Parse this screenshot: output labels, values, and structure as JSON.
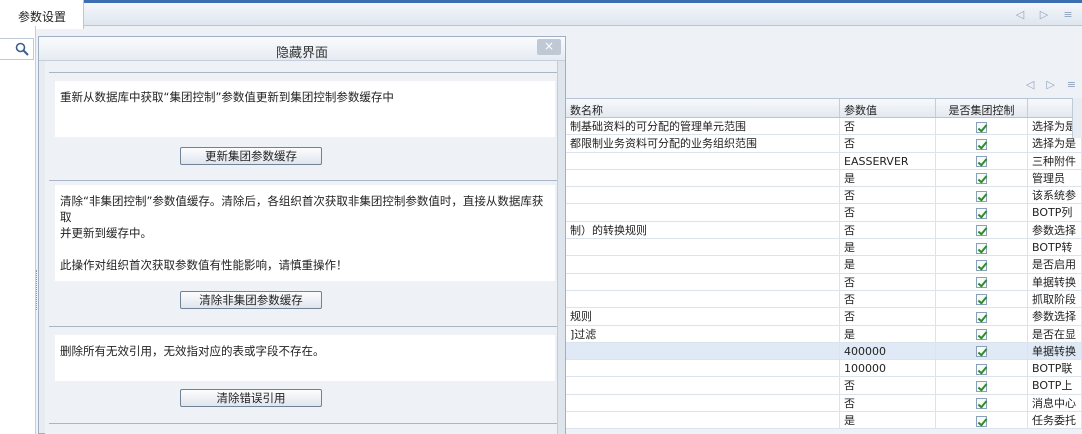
{
  "tabs": {
    "active": "参数设置"
  },
  "dialog": {
    "title": "隐藏界面",
    "close": "×",
    "sections": [
      {
        "lines": [
          "重新从数据库中获取“集团控制”参数值更新到集团控制参数缓存中"
        ],
        "button": "更新集团参数缓存"
      },
      {
        "lines": [
          "清除“非集团控制”参数值缓存。清除后，各组织首次获取非集团控制参数值时，直接从数据库获取",
          "并更新到缓存中。",
          "",
          "此操作对组织首次获取参数值有性能影响，请慎重操作！"
        ],
        "button": "清除非集团参数缓存"
      },
      {
        "lines": [
          "删除所有无效引用，无效指对应的表或字段不存在。"
        ],
        "button": "清除错误引用"
      }
    ]
  },
  "table": {
    "columns": [
      "数名称",
      "参数值",
      "是否集团控制",
      ""
    ],
    "rows": [
      {
        "name": "制基础资料的可分配的管理单元范围",
        "value": "否",
        "desc": "选择为是",
        "sel": false
      },
      {
        "name": "都限制业务资料可分配的业务组织范围",
        "value": "否",
        "desc": "选择为是",
        "sel": false
      },
      {
        "name": "",
        "value": "EASSERVER",
        "desc": "三种附件",
        "sel": false
      },
      {
        "name": "",
        "value": "是",
        "desc": "管理员",
        "sel": false
      },
      {
        "name": "",
        "value": "否",
        "desc": "该系统参",
        "sel": false
      },
      {
        "name": "",
        "value": "否",
        "desc": "BOTP列",
        "sel": false
      },
      {
        "name": "制）的转换规则",
        "value": "否",
        "desc": "参数选择",
        "sel": false
      },
      {
        "name": "",
        "value": "是",
        "desc": "BOTP转",
        "sel": false
      },
      {
        "name": "",
        "value": "是",
        "desc": "是否启用",
        "sel": false
      },
      {
        "name": "",
        "value": "否",
        "desc": "单据转换",
        "sel": false
      },
      {
        "name": "",
        "value": "否",
        "desc": "抓取阶段",
        "sel": false
      },
      {
        "name": "规则",
        "value": "否",
        "desc": "参数选择",
        "sel": false
      },
      {
        "name": "]过滤",
        "value": "是",
        "desc": "是否在显",
        "sel": false
      },
      {
        "name": "",
        "value": "400000",
        "desc": "单据转换",
        "sel": true
      },
      {
        "name": "",
        "value": "100000",
        "desc": "BOTP联",
        "sel": false
      },
      {
        "name": "",
        "value": "否",
        "desc": "BOTP上",
        "sel": false
      },
      {
        "name": "",
        "value": "否",
        "desc": "消息中心",
        "sel": false
      },
      {
        "name": "",
        "value": "是",
        "desc": "任务委托",
        "sel": false
      }
    ]
  },
  "icons": {
    "search": "search-icon",
    "nav_left": "◁",
    "nav_right": "▷",
    "menu": "≡",
    "small_left": "◀",
    "small_right": "▶"
  }
}
